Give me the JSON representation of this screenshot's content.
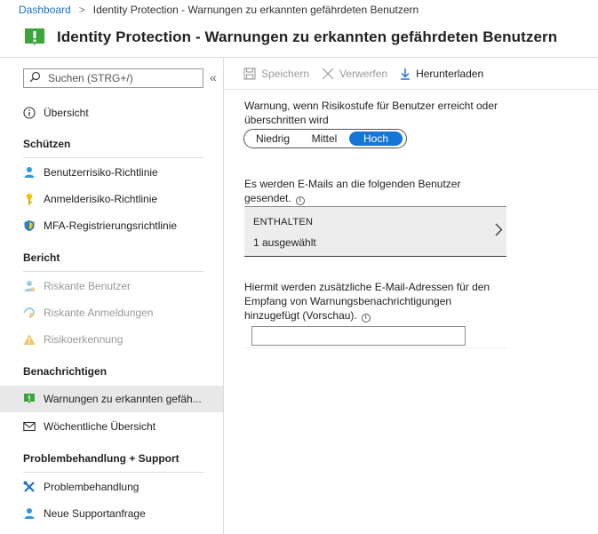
{
  "breadcrumb": {
    "home": "Dashboard",
    "separator": ">",
    "current": "Identity Protection - Warnungen zu erkannten gefährdeten Benutzern"
  },
  "header": {
    "title": "Identity Protection - Warnungen zu erkannten gefährdeten Benutzern",
    "icon": "alert-flag-icon",
    "icon_color": "#3aa63a"
  },
  "sidebar": {
    "search_placeholder": "Suchen (STRG+/)",
    "collapse_label": "«",
    "overview": "Übersicht",
    "sections": {
      "protect": "Schützen",
      "report": "Bericht",
      "notify": "Benachrichtigen",
      "support": "Problembehandlung + Support"
    },
    "items": {
      "user_risk": "Benutzerrisiko-Richtlinie",
      "signin_risk": "Anmelderisiko-Richtlinie",
      "mfa": "MFA-Registrierungsrichtlinie",
      "risky_users": "Riskante Benutzer",
      "risky_signins": "Riskante Anmeldungen",
      "risk_detection": "Risikoerkennung",
      "alerts": "Warnungen zu erkannten gefäh...",
      "weekly": "Wöchentliche Übersicht",
      "troubleshoot": "Problembehandlung",
      "new_request": "Neue Supportanfrage"
    }
  },
  "toolbar": {
    "save": "Speichern",
    "discard": "Verwerfen",
    "download": "Herunterladen"
  },
  "main": {
    "risk_label": "Warnung, wenn Risikostufe für Benutzer erreicht oder überschritten wird",
    "risk_options": [
      "Niedrig",
      "Mittel",
      "Hoch"
    ],
    "risk_selected": "Hoch",
    "email_users_label": "Es werden E-Mails an die folgenden Benutzer gesendet.",
    "include_header": "ENTHALTEN",
    "include_value": "1 ausgewählt",
    "extra_label": "Hiermit werden zusätzliche E-Mail-Adressen für den Empfang von Warnungsbenachrichtigungen hinzugefügt (Vorschau).",
    "extra_email_value": ""
  },
  "colors": {
    "accent": "#1676d4",
    "link": "#1a6fc9",
    "success": "#3aa63a"
  }
}
